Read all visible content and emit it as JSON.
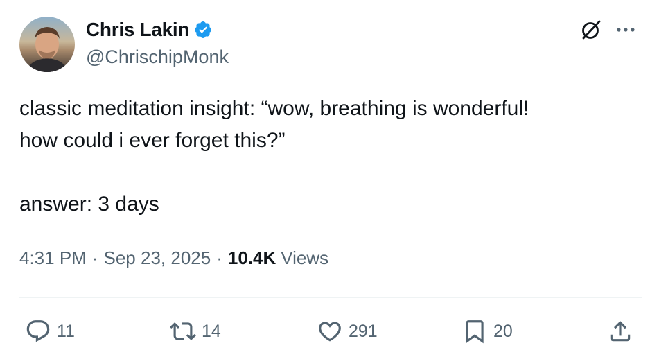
{
  "author": {
    "display_name": "Chris Lakin",
    "handle": "@ChrischipMonk",
    "verified": true,
    "verified_color": "#1d9bf0"
  },
  "tweet": {
    "text": "classic meditation insight: “wow, breathing is wonderful!\nhow could i ever forget this?”\n\nanswer: 3 days"
  },
  "meta": {
    "time": "4:31 PM",
    "separator": "·",
    "date": "Sep 23, 2025",
    "views_count": "10.4K",
    "views_label": "Views"
  },
  "actions": {
    "replies": "11",
    "reposts": "14",
    "likes": "291",
    "bookmarks": "20"
  },
  "icons": [
    "grok-icon",
    "more-icon",
    "verified-badge-icon",
    "reply-icon",
    "repost-icon",
    "like-icon",
    "bookmark-icon",
    "share-icon"
  ],
  "colors": {
    "text": "#0f1419",
    "secondary": "#536471",
    "accent": "#1d9bf0",
    "divider": "#eff3f4"
  }
}
